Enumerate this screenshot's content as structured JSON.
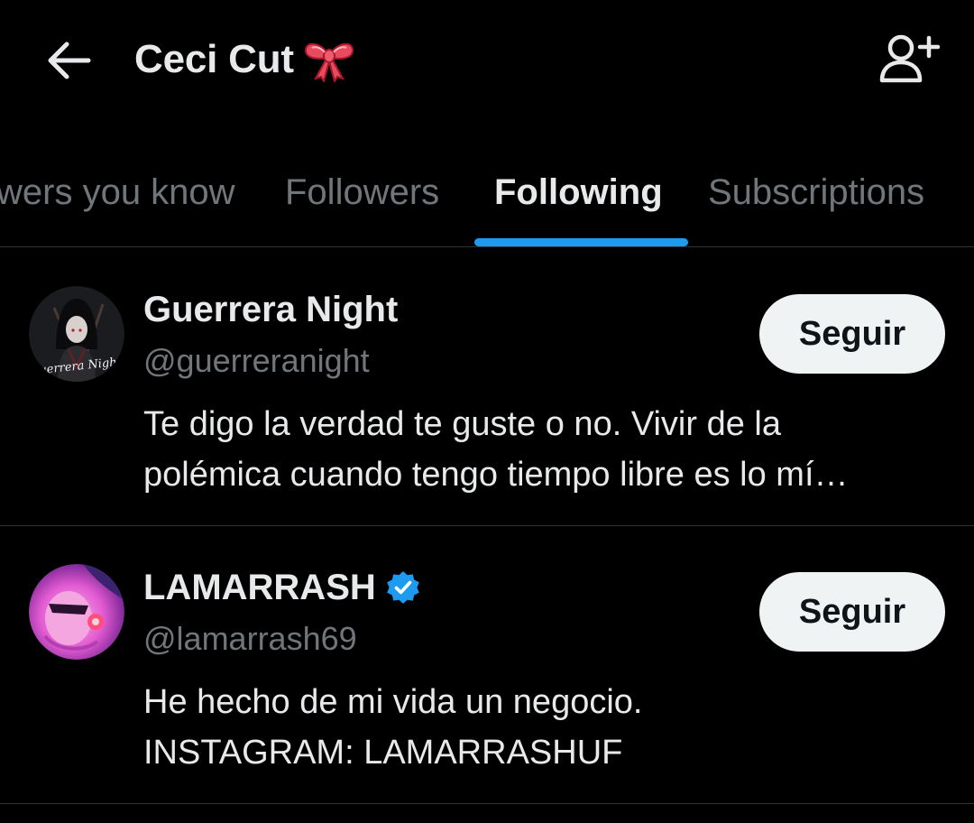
{
  "header": {
    "title": "Ceci Cut",
    "title_emoji": "bow-icon",
    "back_icon": "arrow-left-icon",
    "add_user_icon": "person-plus-icon"
  },
  "tabs": [
    {
      "label": "Followers you know",
      "visible_text": "wers you know",
      "active": false
    },
    {
      "label": "Followers",
      "active": false
    },
    {
      "label": "Following",
      "active": true
    },
    {
      "label": "Subscriptions",
      "active": false
    }
  ],
  "accent_color": "#1d9bf0",
  "users": [
    {
      "name": "Guerrera Night",
      "handle": "@guerreranight",
      "verified": false,
      "avatar_text": "Guerrera Night",
      "follow_label": "Seguir",
      "bio_lines": [
        "Te digo la verdad te guste o no. Vivir de la",
        "polémica cuando tengo tiempo libre es lo mí…"
      ]
    },
    {
      "name": "LAMARRASH",
      "handle": "@lamarrash69",
      "verified": true,
      "follow_label": "Seguir",
      "bio_lines": [
        "He hecho de mi vida un negocio.",
        "INSTAGRAM: LAMARRASHUF"
      ]
    }
  ]
}
